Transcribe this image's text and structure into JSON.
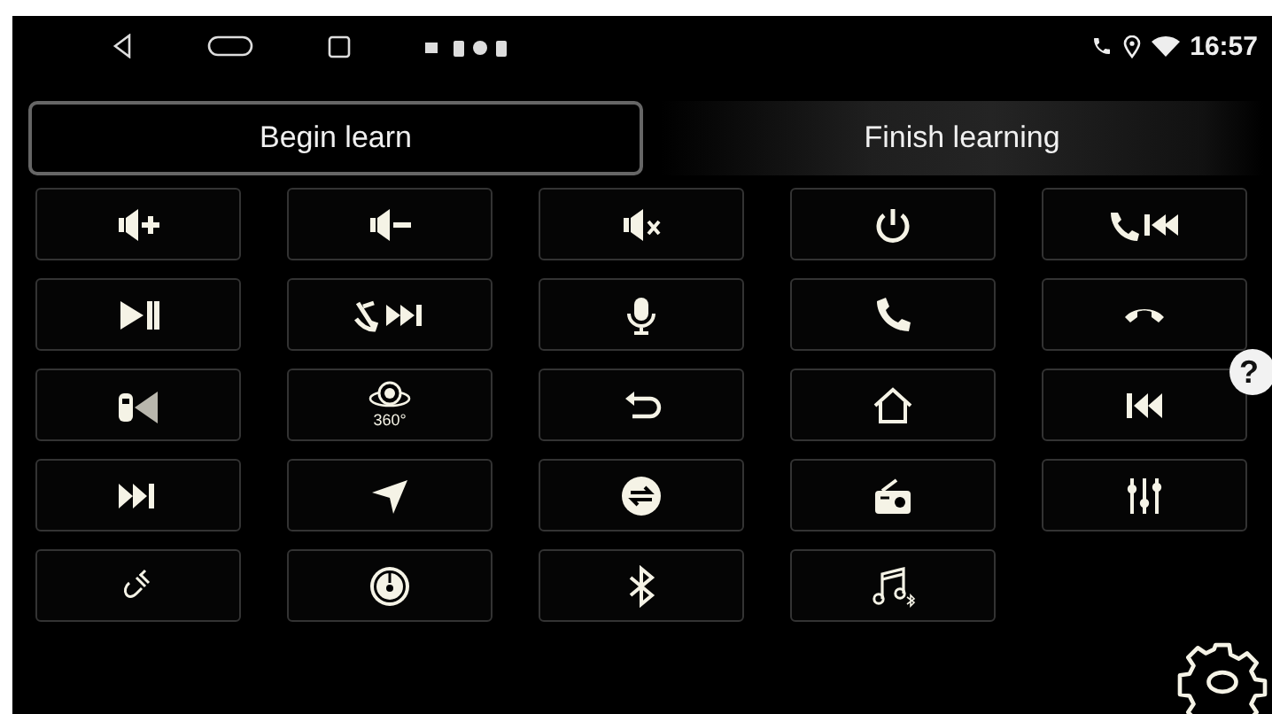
{
  "status_bar": {
    "time": "16:57"
  },
  "tabs": [
    {
      "label": "Begin learn",
      "selected": true
    },
    {
      "label": "Finish learning",
      "selected": false
    }
  ],
  "keys": [
    {
      "kind": "volume-up"
    },
    {
      "kind": "volume-down"
    },
    {
      "kind": "mute"
    },
    {
      "kind": "power"
    },
    {
      "kind": "phone-previous"
    },
    {
      "kind": "play-pause"
    },
    {
      "kind": "hangup-next"
    },
    {
      "kind": "microphone"
    },
    {
      "kind": "phone"
    },
    {
      "kind": "hang-up"
    },
    {
      "kind": "car-camera"
    },
    {
      "kind": "camera-360",
      "caption": "360°"
    },
    {
      "kind": "back"
    },
    {
      "kind": "home"
    },
    {
      "kind": "previous"
    },
    {
      "kind": "next"
    },
    {
      "kind": "navigation"
    },
    {
      "kind": "mode-switch"
    },
    {
      "kind": "fm-tuner"
    },
    {
      "kind": "equalizer"
    },
    {
      "kind": "aux-cable"
    },
    {
      "kind": "disc"
    },
    {
      "kind": "bluetooth"
    },
    {
      "kind": "bluetooth-music"
    }
  ],
  "help_button": {
    "label": "?"
  }
}
